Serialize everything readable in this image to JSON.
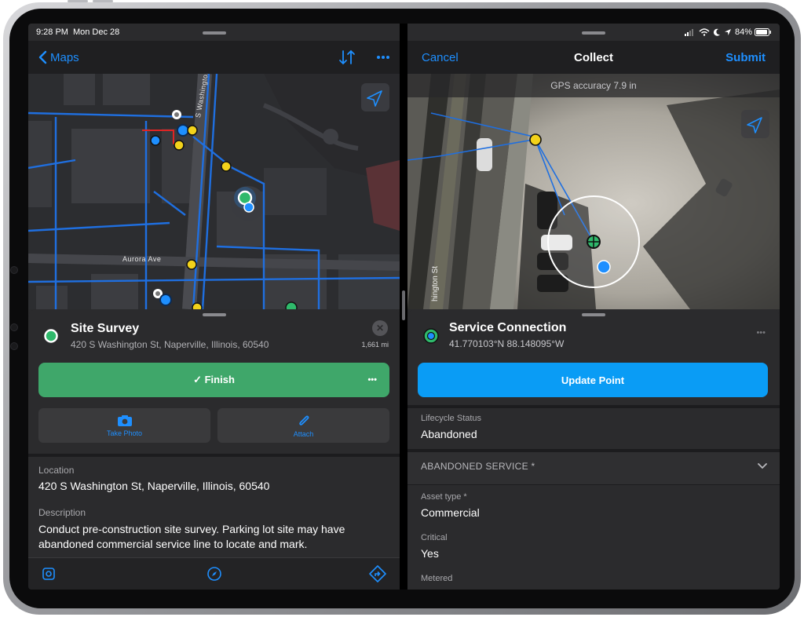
{
  "left": {
    "status": {
      "time": "9:28 PM",
      "date": "Mon Dec 28"
    },
    "nav": {
      "back_label": "Maps"
    },
    "map": {
      "street_label_1": "S Washington St",
      "street_label_2": "Aurora Ave"
    },
    "sheet": {
      "title": "Site Survey",
      "address": "420 S Washington St, Naperville, Illinois, 60540",
      "distance": "1,661 mi",
      "finish_label": "✓ Finish",
      "more_label": "•••",
      "photo_label": "Take Photo",
      "attach_label": "Attach"
    },
    "details": {
      "location_label": "Location",
      "location_value": "420 S Washington St, Naperville, Illinois, 60540",
      "description_label": "Description",
      "description_value": "Conduct pre-construction site survey. Parking lot site may have abandoned commercial service line to locate and mark."
    }
  },
  "right": {
    "status": {
      "battery": "84%"
    },
    "nav": {
      "cancel_label": "Cancel",
      "title": "Collect",
      "submit_label": "Submit"
    },
    "map": {
      "gps_accuracy": "GPS accuracy 7.9 in",
      "street_label": "hington St"
    },
    "sheet": {
      "title": "Service Connection",
      "coordinates": "41.770103°N  88.148095°W",
      "more_label": "•••",
      "update_label": "Update Point"
    },
    "fields": {
      "lifecycle_label": "Lifecycle Status",
      "lifecycle_value": "Abandoned",
      "section_title": "ABANDONED SERVICE *",
      "asset_label": "Asset type *",
      "asset_value": "Commercial",
      "critical_label": "Critical",
      "critical_value": "Yes",
      "metered_label": "Metered"
    }
  },
  "colors": {
    "accent": "#1e8fff",
    "finish_green": "#3fa76a",
    "update_blue": "#0a9cf5",
    "pipeline_blue": "#1f6fe0",
    "feature_yellow": "#f2d21b"
  }
}
